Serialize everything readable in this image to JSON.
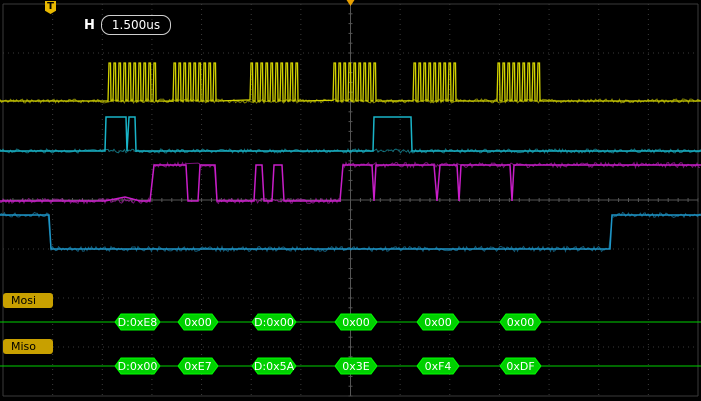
{
  "timebase": {
    "label": "H",
    "value": "1.500us"
  },
  "trigger": {
    "marker": "T"
  },
  "colors": {
    "background": "#000000",
    "grid": "#3a3a3a",
    "ch1": "#d4d400",
    "ch2": "#19b4c8",
    "ch3": "#c81ec8",
    "ch4": "#1e96c8",
    "bus": "#00d000",
    "bus_text": "#ffffff",
    "bus_label_bg": "#c8a000"
  },
  "buses": [
    {
      "name": "Mosi",
      "frames": [
        "D:0xE8",
        "0x00",
        "D:0x00",
        "0x00",
        "0x00",
        "0x00"
      ]
    },
    {
      "name": "Miso",
      "frames": [
        "D:0x00",
        "0xE7",
        "D:0x5A",
        "0x3E",
        "0xF4",
        "0xDF"
      ]
    }
  ]
}
